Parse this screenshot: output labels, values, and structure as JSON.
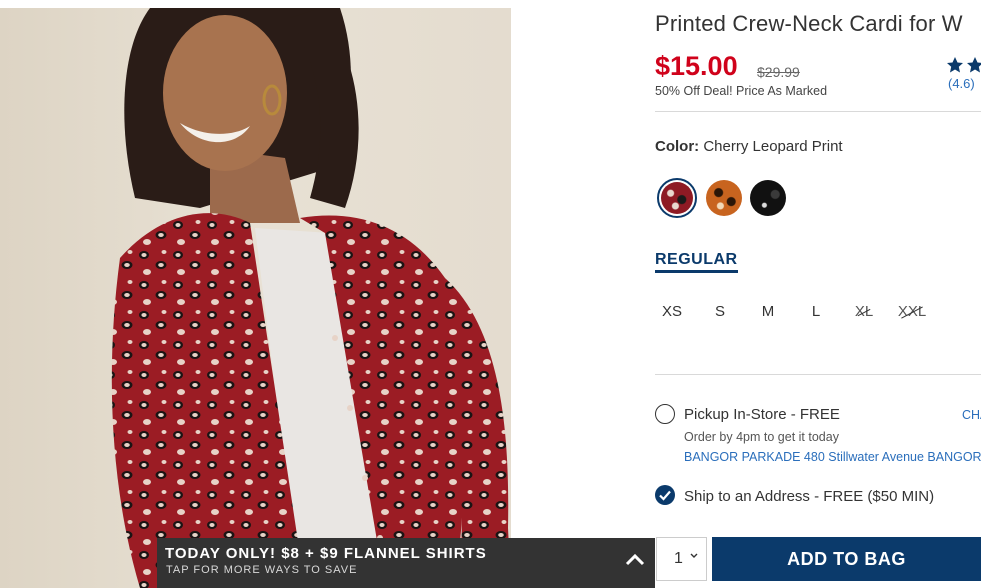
{
  "product": {
    "title": "Printed Crew-Neck Cardi for W",
    "price": "$15.00",
    "old_price": "$29.99",
    "deal": "50% Off Deal! Price As Marked",
    "rating": "(4.6)",
    "rating_value": 4.6
  },
  "color": {
    "label": "Color:",
    "selected": "Cherry Leopard Print",
    "swatches": [
      "cherry-leopard-print",
      "tan-leopard-print",
      "black-print"
    ]
  },
  "fit": {
    "tab": "REGULAR"
  },
  "sizes": [
    {
      "label": "XS",
      "available": true
    },
    {
      "label": "S",
      "available": true
    },
    {
      "label": "M",
      "available": true
    },
    {
      "label": "L",
      "available": true
    },
    {
      "label": "XL",
      "available": false
    },
    {
      "label": "XXL",
      "available": false
    }
  ],
  "delivery": {
    "pickup_label": "Pickup In-Store - FREE",
    "pickup_sub": "Order by 4pm to get it today",
    "pickup_store": "BANGOR PARKADE 480 Stillwater Avenue  BANGOR",
    "change_link": "CHA",
    "ship_label": "Ship to an Address - FREE ($50 MIN)"
  },
  "cart": {
    "qty": "1",
    "add_label": "ADD TO BAG"
  },
  "promo": {
    "title": "TODAY ONLY! $8 + $9 FLANNEL SHIRTS",
    "subtitle": "TAP FOR MORE WAYS TO SAVE"
  },
  "colors": {
    "brand_navy": "#0b3a6b",
    "sale_red": "#d0021b",
    "link_blue": "#2a6ebb",
    "promo_bg": "#333333"
  }
}
